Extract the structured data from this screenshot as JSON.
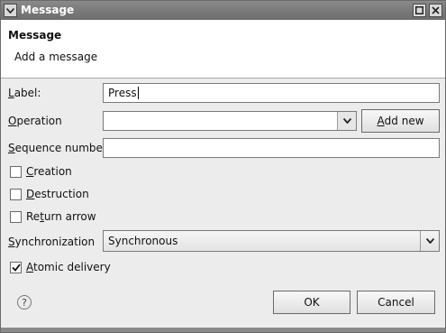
{
  "window": {
    "title": "Message"
  },
  "banner": {
    "title": "Message",
    "subtitle": "Add a message"
  },
  "form": {
    "label": {
      "caption_u": "L",
      "caption_rest": "abel:",
      "value": "Press"
    },
    "operation": {
      "caption_u": "O",
      "caption_rest": "peration",
      "value": "",
      "add_new_u": "A",
      "add_new_rest": "dd new"
    },
    "sequence": {
      "caption_u": "S",
      "caption_rest": "equence number",
      "value": ""
    },
    "creation": {
      "caption_u": "C",
      "caption_rest": "reation",
      "checked": false
    },
    "destruction": {
      "caption_u": "D",
      "caption_rest": "estruction",
      "checked": false
    },
    "return_arrow": {
      "caption_pre": "Re",
      "caption_u": "t",
      "caption_rest": "urn arrow",
      "checked": false
    },
    "synchronization": {
      "caption_u": "S",
      "caption_rest": "ynchronization",
      "value": "Synchronous"
    },
    "atomic": {
      "caption_u": "A",
      "caption_rest": "tomic delivery",
      "checked": true
    }
  },
  "footer": {
    "help_glyph": "?",
    "ok_label": "OK",
    "cancel_label": "Cancel"
  }
}
